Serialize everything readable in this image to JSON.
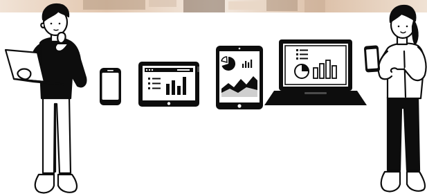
{
  "colors": {
    "ink": "#0d0d0d",
    "paper": "#ffffff",
    "screen_gray": "#cfcfcf",
    "photo_warm": "#e6cdb7",
    "photo_light": "#f3e6d9",
    "photo_dark": "#8a7564"
  },
  "illustration": {
    "people": [
      {
        "name": "left-person",
        "holding": "laptop-icon",
        "pose": "thinking"
      },
      {
        "name": "right-person",
        "holding": "smartphone-icon",
        "pose": "pointing"
      }
    ],
    "devices": [
      {
        "name": "smartphone-icon",
        "screen": "blank"
      },
      {
        "name": "tablet-landscape-icon",
        "screen": "list-and-bar-chart"
      },
      {
        "name": "tablet-portrait-icon",
        "screen": "pie-and-area-chart"
      },
      {
        "name": "laptop-icon",
        "screen": "list-pie-and-bar-chart"
      }
    ]
  }
}
